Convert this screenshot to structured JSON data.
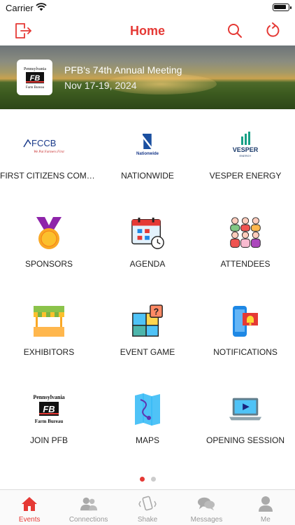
{
  "status": {
    "carrier": "Carrier"
  },
  "nav": {
    "title": "Home"
  },
  "banner": {
    "title": "PFB's 74th Annual Meeting",
    "dates": "Nov 17-19, 2024",
    "logo_text": "Pennsylvania",
    "logo_sub": "Farm Bureau"
  },
  "tiles": [
    {
      "label": "FIRST CITIZENS COMM...",
      "icon": "fccb-logo",
      "logo_text": "FCCB",
      "logo_sub": "We Put Farmers First"
    },
    {
      "label": "NATIONWIDE",
      "icon": "nationwide-logo",
      "logo_text": "Nationwide"
    },
    {
      "label": "VESPER ENERGY",
      "icon": "vesper-logo",
      "logo_text": "VESPER",
      "logo_sub": "ENERGY"
    },
    {
      "label": "SPONSORS",
      "icon": "medal-icon"
    },
    {
      "label": "AGENDA",
      "icon": "calendar-icon"
    },
    {
      "label": "ATTENDEES",
      "icon": "people-icon"
    },
    {
      "label": "EXHIBITORS",
      "icon": "booth-icon"
    },
    {
      "label": "EVENT GAME",
      "icon": "puzzle-icon"
    },
    {
      "label": "NOTIFICATIONS",
      "icon": "bell-phone-icon"
    },
    {
      "label": "JOIN PFB",
      "icon": "pfb-logo",
      "logo_text": "Pennsylvania",
      "logo_sub": "Farm Bureau"
    },
    {
      "label": "MAPS",
      "icon": "map-icon"
    },
    {
      "label": "OPENING SESSION",
      "icon": "video-laptop-icon"
    }
  ],
  "pager": {
    "pages": 2,
    "current": 1
  },
  "tabs": [
    {
      "label": "Events",
      "icon": "home-icon",
      "active": true
    },
    {
      "label": "Connections",
      "icon": "connections-icon",
      "active": false
    },
    {
      "label": "Shake",
      "icon": "shake-icon",
      "active": false
    },
    {
      "label": "Messages",
      "icon": "messages-icon",
      "active": false
    },
    {
      "label": "Me",
      "icon": "person-icon",
      "active": false
    }
  ],
  "colors": {
    "accent": "#e53935",
    "inactive": "#999999"
  }
}
